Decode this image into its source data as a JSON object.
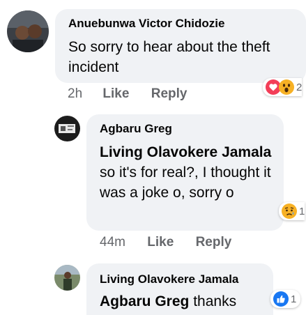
{
  "comments": [
    {
      "author": "Anuebunwa Victor Chidozie",
      "text": "So sorry to hear about the theft incident",
      "time": "2h",
      "like_label": "Like",
      "reply_label": "Reply",
      "reactions": [
        "love",
        "wow"
      ],
      "reaction_count": "2"
    },
    {
      "author": "Agbaru Greg",
      "mention": "Living Olavokere Jamala",
      "text": "so it's for real?, I thought it was a joke o,  sorry o",
      "time": "44m",
      "like_label": "Like",
      "reply_label": "Reply",
      "reactions": [
        "sad"
      ],
      "reaction_count": "1"
    },
    {
      "author": "Living Olavokere Jamala",
      "mention": "Agbaru Greg",
      "text": "thanks",
      "reactions": [
        "like"
      ],
      "reaction_count": "1"
    }
  ],
  "colors": {
    "bubble": "#f0f2f5",
    "meta_text": "#65676b",
    "like_blue": "#1877f2",
    "love_red": "#f33e58",
    "wow_yellow": "#f7b125"
  }
}
